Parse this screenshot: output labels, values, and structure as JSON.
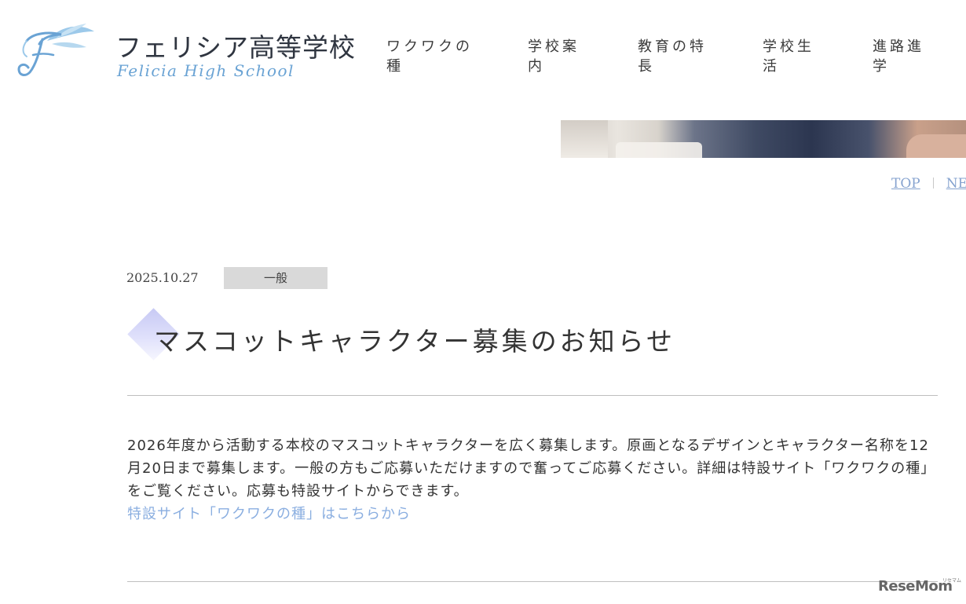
{
  "header": {
    "logo_jp": "フェリシア高等学校",
    "logo_en": "Felicia High School",
    "nav": [
      {
        "label": "ワクワクの種"
      },
      {
        "label": "学校案内"
      },
      {
        "label": "教育の特長"
      },
      {
        "label": "学校生活"
      },
      {
        "label": "進路進学"
      }
    ]
  },
  "breadcrumb": {
    "items": [
      "TOP",
      "NE"
    ]
  },
  "article": {
    "date": "2025.10.27",
    "category": "一般",
    "title": "マスコットキャラクター募集のお知らせ",
    "body": "2026年度から活動する本校のマスコットキャラクターを広く募集します。原画となるデザインとキャラクター名称を12月20日まで募集します。一般の方もご応募いただけますので奮ってご応募ください。詳細は特設サイト「ワクワクの種」をご覧ください。応募も特設サイトからできます。",
    "link_text": "特設サイト「ワクワクの種」はこちらから"
  },
  "watermark": {
    "text": "ReseMom",
    "ruby": "リセマム"
  },
  "colors": {
    "link": "#8aaee0",
    "breadcrumb": "#86a3cf",
    "logo_accent": "#6aa3d4",
    "category_bg": "#d9d9d9",
    "diamond": "#c7c9f4"
  }
}
